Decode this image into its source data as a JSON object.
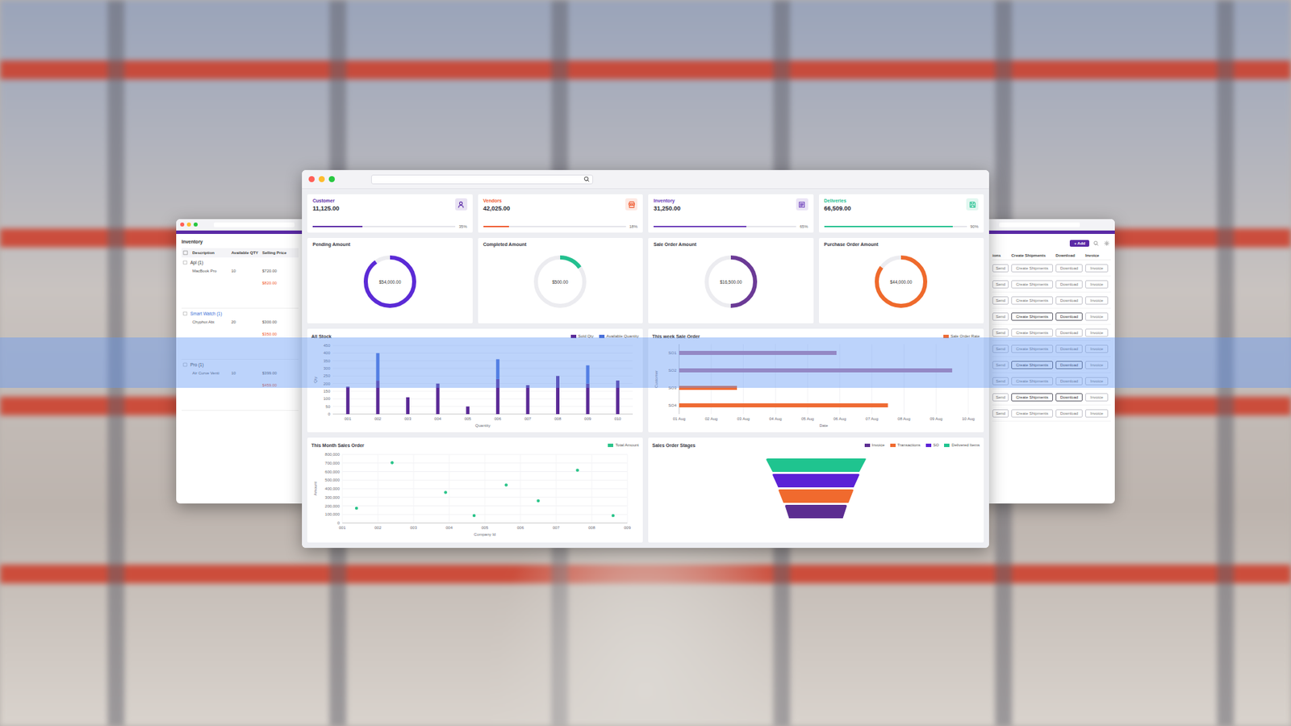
{
  "main_window": {
    "stats": [
      {
        "label": "Customer",
        "value": "11,125.00",
        "level": 0.35,
        "percent": "35%",
        "color": "#5b2aa6"
      },
      {
        "label": "Vendors",
        "value": "42,025.00",
        "level": 0.18,
        "percent": "18%",
        "color": "#ef5a2f"
      },
      {
        "label": "Inventory",
        "value": "31,250.00",
        "level": 0.65,
        "percent": "65%",
        "color": "#6a3bb8"
      },
      {
        "label": "Deliveries",
        "value": "66,509.00",
        "level": 0.9,
        "percent": "90%",
        "color": "#23c08f"
      }
    ],
    "donuts": [
      {
        "title": "Pending Amount",
        "value": "$54,000.00",
        "level": 0.9,
        "color": "#5b2ad6"
      },
      {
        "title": "Completed Amount",
        "value": "$500.00",
        "level": 0.15,
        "color": "#23c08f"
      },
      {
        "title": "Sale Order Amount",
        "value": "$16,500.00",
        "level": 0.5,
        "color": "#6b3a96"
      },
      {
        "title": "Purchase Order Amount",
        "value": "$44,000.00",
        "level": 0.85,
        "color": "#ef6a2c"
      }
    ],
    "stock_chart": {
      "title": "All Stock",
      "y_title": "Qty",
      "x_title": "Quantity",
      "y_ticks": [
        "0",
        "50",
        "100",
        "150",
        "200",
        "250",
        "300",
        "350",
        "400",
        "450"
      ],
      "x_labels": [
        "001",
        "002",
        "003",
        "004",
        "005",
        "006",
        "007",
        "008",
        "009",
        "010"
      ],
      "series": [
        {
          "label": "Sold Qty",
          "color": "#5b2a96",
          "values": [
            180,
            220,
            110,
            200,
            50,
            230,
            190,
            250,
            200,
            220
          ]
        },
        {
          "label": "Available Quantity",
          "color": "#4a6fd8",
          "values": [
            0,
            180,
            0,
            0,
            0,
            130,
            0,
            0,
            120,
            0
          ]
        }
      ]
    },
    "week_chart": {
      "title": "This week Sale Order",
      "legend": {
        "label": "Sale Order Rate",
        "color": "#ef6c35"
      },
      "y_title": "Customer",
      "x_title": "Date",
      "x_ticks": [
        "01 Aug",
        "02 Aug",
        "03 Aug",
        "04 Aug",
        "05 Aug",
        "06 Aug",
        "07 Aug",
        "08 Aug",
        "09 Aug",
        "10 Aug"
      ],
      "rows": [
        {
          "label": "SO1",
          "value": 4.9,
          "color": "#b97fa3"
        },
        {
          "label": "SO2",
          "value": 8.5,
          "color": "#b97fa3"
        },
        {
          "label": "SO3",
          "value": 1.8,
          "color": "#ef6c35"
        },
        {
          "label": "SO4",
          "value": 6.5,
          "color": "#ef6c35"
        }
      ]
    },
    "month_chart": {
      "title": "This Month Sales Order",
      "legend": "Total Amount",
      "color": "#2bc48a",
      "y_title": "Amount",
      "x_title": "Company Id",
      "y_ticks": [
        "0",
        "100,000",
        "200,000",
        "300,000",
        "400,000",
        "500,000",
        "600,000",
        "700,000",
        "800,000"
      ],
      "x_ticks": [
        "001",
        "002",
        "003",
        "004",
        "005",
        "006",
        "007",
        "008",
        "009"
      ],
      "points": [
        {
          "x": 0.4,
          "y": 173000
        },
        {
          "x": 1.4,
          "y": 703000
        },
        {
          "x": 2.9,
          "y": 357000
        },
        {
          "x": 3.7,
          "y": 86000
        },
        {
          "x": 4.6,
          "y": 443000
        },
        {
          "x": 5.5,
          "y": 259000
        },
        {
          "x": 6.6,
          "y": 616000
        },
        {
          "x": 7.6,
          "y": 86000
        }
      ]
    },
    "funnel": {
      "title": "Sales Order Stages",
      "stages": [
        {
          "label": "Delivered Items",
          "color": "#1fc48f",
          "level": 1.0
        },
        {
          "label": "SO",
          "color": "#5b21d6",
          "level": 0.87
        },
        {
          "label": "Transactions",
          "color": "#f06a2e",
          "level": 0.75
        },
        {
          "label": "Invoice",
          "color": "#5c2d91",
          "level": 0.62
        }
      ]
    }
  },
  "inventory_window": {
    "title": "Inventory",
    "columns": [
      "Description",
      "Available QTY",
      "Selling Price"
    ],
    "groups": [
      {
        "name": "Apl (1)",
        "selected": false,
        "item": "MacBook Pro",
        "qty": "10",
        "price": "$720.00",
        "cost": "$820.00"
      },
      {
        "name": "Smart Watch (1)",
        "selected": true,
        "item": "Chyphot Abt",
        "qty": "20",
        "price": "$300.00",
        "cost": "$350.00"
      },
      {
        "name": "Pro (1)",
        "selected": false,
        "item": "Air Curve Venti",
        "qty": "10",
        "price": "$399.00",
        "cost": "$459.00"
      }
    ]
  },
  "shipments_window": {
    "add_button": "+ Add",
    "columns": [
      "ions",
      "Create Shipments",
      "Download",
      "Invoice"
    ],
    "rows": [
      {
        "buttons": [
          "Send",
          "Create Shipments",
          "Download",
          "Invoice"
        ],
        "highlighted": false
      },
      {
        "buttons": [
          "Send",
          "Create Shipments",
          "Download",
          "Invoice"
        ],
        "highlighted": false
      },
      {
        "buttons": [
          "Send",
          "Create Shipments",
          "Download",
          "Invoice"
        ],
        "highlighted": false
      },
      {
        "buttons": [
          "Send",
          "Create Shipments",
          "Download",
          "Invoice"
        ],
        "highlighted": true
      },
      {
        "buttons": [
          "Send",
          "Create Shipments",
          "Download",
          "Invoice"
        ],
        "highlighted": false
      },
      {
        "buttons": [
          "Send",
          "Create Shipments",
          "Download",
          "Invoice"
        ],
        "highlighted": false
      },
      {
        "buttons": [
          "Send",
          "Create Shipments",
          "Download",
          "Invoice"
        ],
        "highlighted": true
      },
      {
        "buttons": [
          "Send",
          "Create Shipments",
          "Download",
          "Invoice"
        ],
        "highlighted": false
      },
      {
        "buttons": [
          "Send",
          "Create Shipments",
          "Download",
          "Invoice"
        ],
        "highlighted": true
      },
      {
        "buttons": [
          "Send",
          "Create Shipments",
          "Download",
          "Invoice"
        ],
        "highlighted": false
      }
    ]
  }
}
